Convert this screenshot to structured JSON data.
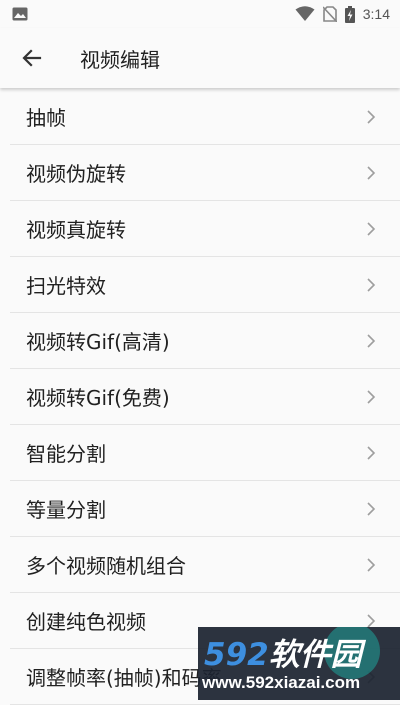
{
  "status_bar": {
    "time": "3:14",
    "icons": [
      "image-icon",
      "wifi-icon",
      "no-sim-icon",
      "battery-charging-icon"
    ]
  },
  "app_bar": {
    "title": "视频编辑",
    "back_icon": "arrow-back-icon"
  },
  "menu_items": [
    {
      "label": "抽帧"
    },
    {
      "label": "视频伪旋转"
    },
    {
      "label": "视频真旋转"
    },
    {
      "label": "扫光特效"
    },
    {
      "label": "视频转Gif(高清)"
    },
    {
      "label": "视频转Gif(免费)"
    },
    {
      "label": "智能分割"
    },
    {
      "label": "等量分割"
    },
    {
      "label": "多个视频随机组合"
    },
    {
      "label": "创建纯色视频"
    },
    {
      "label": "调整帧率(抽帧)和码率"
    }
  ],
  "watermark": {
    "brand_num": "592",
    "brand_text": "软件园",
    "url": "www.592xiazai.com"
  },
  "colors": {
    "background": "#fafafa",
    "text": "#212121",
    "divider": "#e4e4e4",
    "chevron": "#9e9e9e"
  }
}
